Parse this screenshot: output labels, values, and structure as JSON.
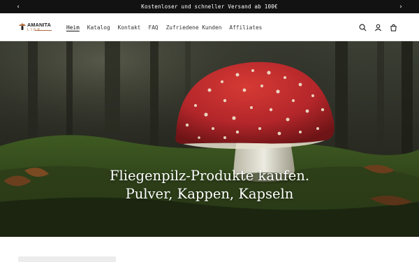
{
  "announcement": {
    "text": "Kostenloser und schneller Versand ab 100€",
    "prev_arrow": "‹",
    "next_arrow": "›"
  },
  "brand": {
    "name_top": "AMANITA",
    "name_bottom": "LIFE",
    "accent_color": "#b06a3c"
  },
  "nav": {
    "items": [
      {
        "label": "Heim",
        "active": true
      },
      {
        "label": "Katalog",
        "active": false
      },
      {
        "label": "Kontakt",
        "active": false
      },
      {
        "label": "FAQ",
        "active": false
      },
      {
        "label": "Zufriedene Kunden",
        "active": false
      },
      {
        "label": "Affiliates",
        "active": false
      }
    ]
  },
  "header_icons": [
    "search-icon",
    "account-icon",
    "cart-icon"
  ],
  "hero": {
    "line1": "Fliegenpilz-Produkte kaufen.",
    "line2": "Pulver, Kappen, Kapseln",
    "image": "fly-agaric-mushroom-in-forest"
  },
  "colors": {
    "announcement_bg": "#121212",
    "cap_red": "#b3262a",
    "moss_green": "#3f5a22"
  }
}
